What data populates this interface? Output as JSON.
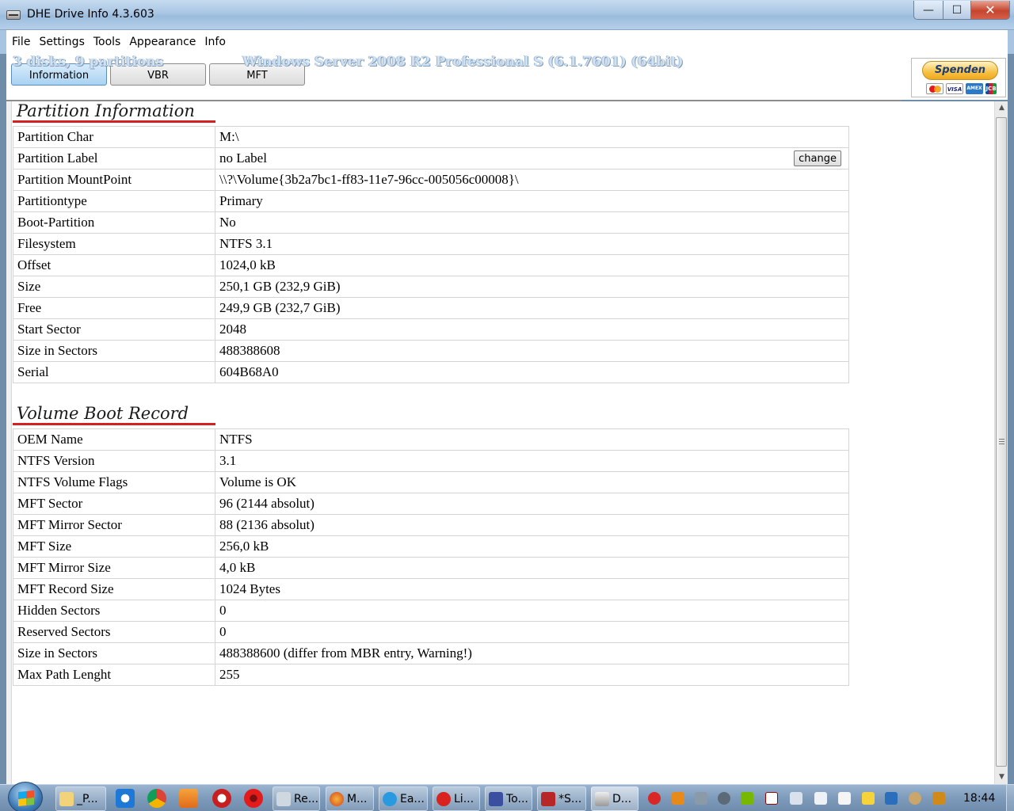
{
  "window": {
    "title": "DHE Drive Info 4.3.603",
    "minimize_glyph": "—",
    "maximize_glyph": "☐",
    "close_glyph": "✕"
  },
  "menu": [
    "File",
    "Settings",
    "Tools",
    "Appearance",
    "Info"
  ],
  "header": {
    "disks_text": "3 disks, 9 partitions",
    "os_text": "Windows Server 2008 R2 Professional S (6.1.7601)  (64bit)",
    "tabs": [
      "Information",
      "VBR",
      "MFT"
    ],
    "active_tab": "Information",
    "donate_label": "Spenden",
    "card_visa": "VISA",
    "card_amex": "AMEX",
    "card_jcb": "JCB"
  },
  "partition_info": {
    "title": "Partition Information",
    "change_label": "change",
    "rows": [
      {
        "key": "Partition Char",
        "value": "M:\\"
      },
      {
        "key": "Partition Label",
        "value": "no Label"
      },
      {
        "key": "Partition MountPoint",
        "value": "\\\\?\\Volume{3b2a7bc1-ff83-11e7-96cc-005056c00008}\\"
      },
      {
        "key": "Partitiontype",
        "value": "Primary"
      },
      {
        "key": "Boot-Partition",
        "value": "No"
      },
      {
        "key": "Filesystem",
        "value": "NTFS 3.1"
      },
      {
        "key": "Offset",
        "value": "1024,0 kB"
      },
      {
        "key": "Size",
        "value": "250,1 GB (232,9 GiB)"
      },
      {
        "key": "Free",
        "value": "249,9 GB (232,7 GiB)"
      },
      {
        "key": "Start Sector",
        "value": "2048"
      },
      {
        "key": "Size in Sectors",
        "value": "488388608"
      },
      {
        "key": "Serial",
        "value": "604B68A0"
      }
    ]
  },
  "vbr": {
    "title": "Volume Boot Record",
    "rows": [
      {
        "key": "OEM Name",
        "value": "NTFS"
      },
      {
        "key": "NTFS Version",
        "value": "3.1"
      },
      {
        "key": "NTFS Volume Flags",
        "value": "Volume is OK"
      },
      {
        "key": "MFT Sector",
        "value": "96 (2144 absolut)"
      },
      {
        "key": "MFT Mirror Sector",
        "value": "88 (2136 absolut)"
      },
      {
        "key": "MFT Size",
        "value": "256,0 kB"
      },
      {
        "key": "MFT Mirror Size",
        "value": "4,0 kB"
      },
      {
        "key": "MFT Record Size",
        "value": "1024 Bytes"
      },
      {
        "key": "Hidden Sectors",
        "value": "0"
      },
      {
        "key": "Reserved Sectors",
        "value": "0"
      },
      {
        "key": "Size in Sectors",
        "value": "488388600 (differ from MBR entry, Warning!)"
      },
      {
        "key": "Max Path Lenght",
        "value": "255"
      }
    ]
  },
  "scrollbar": {
    "up": "▲",
    "down": "▼"
  },
  "taskbar": {
    "buttons": [
      "_P...",
      "Re...",
      "M...",
      "Ea...",
      "Li...",
      "To...",
      "*S...",
      "D..."
    ],
    "clock": "18:44"
  },
  "colors": {
    "section_underline": "#d42020",
    "titlebar": "#a9c6e4",
    "taskbar": "#7e9bbb"
  }
}
